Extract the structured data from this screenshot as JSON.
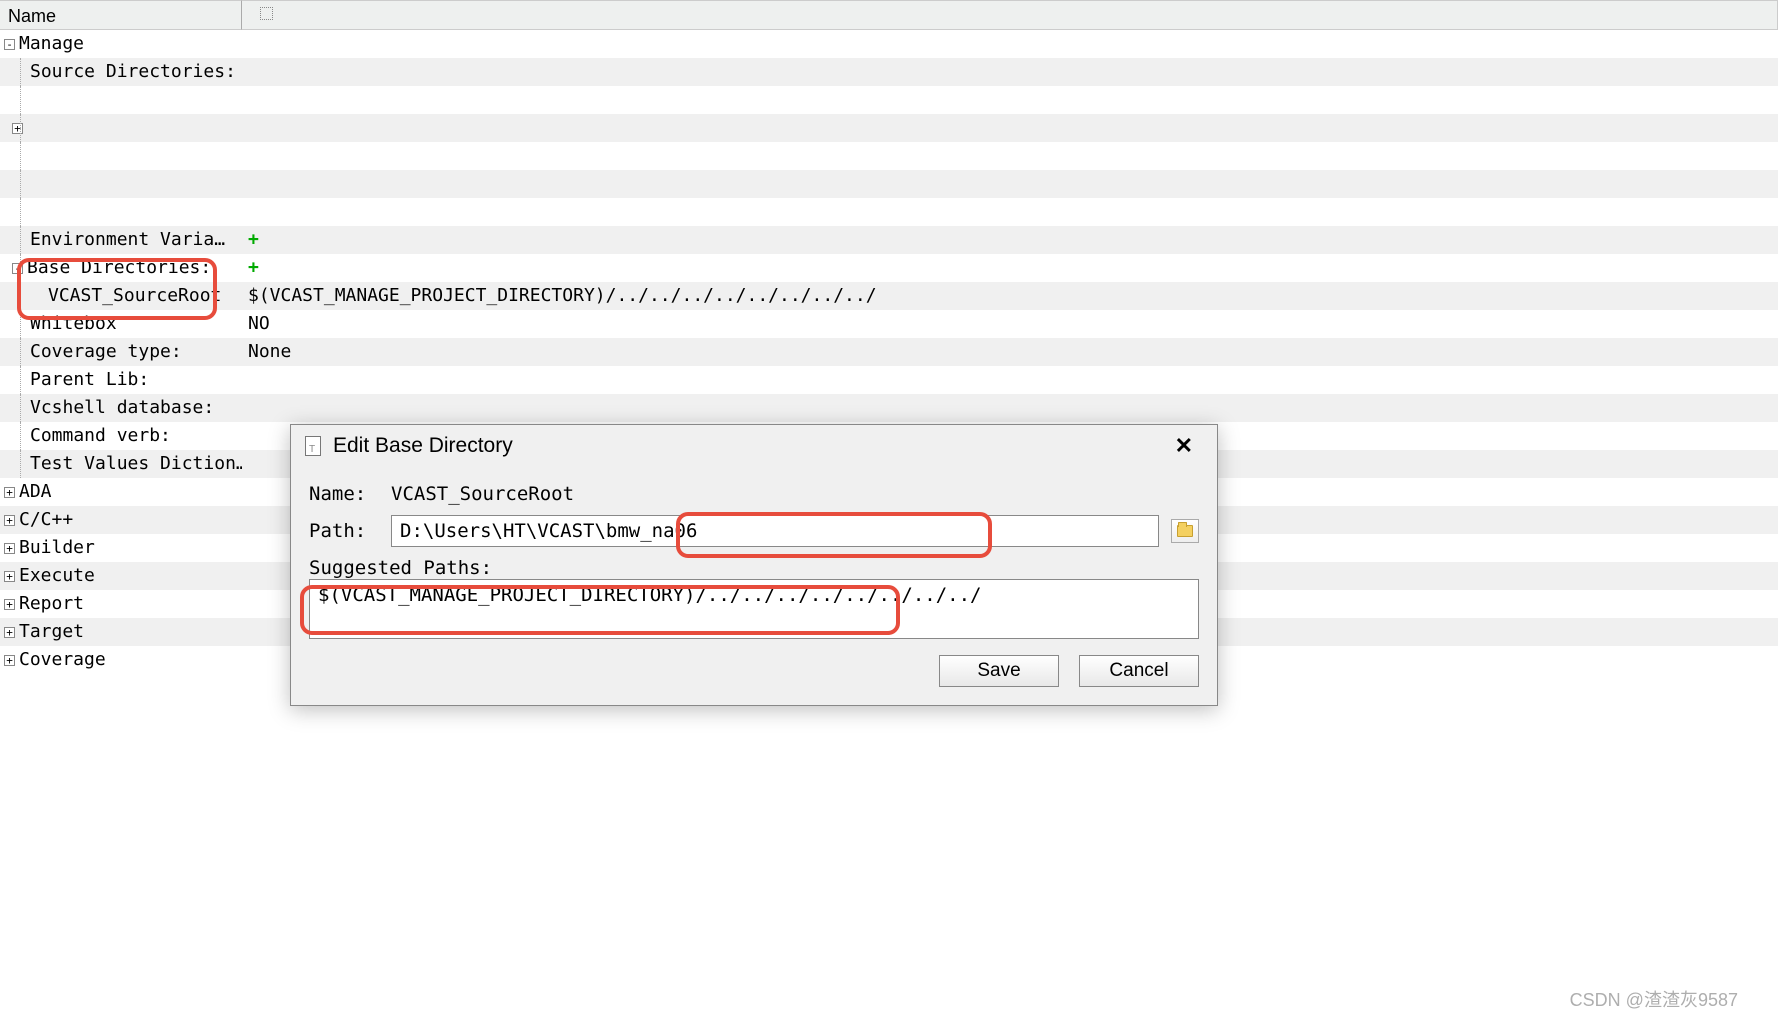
{
  "header": {
    "name_col": "Name"
  },
  "tree": {
    "manage": {
      "label": "Manage",
      "source_dirs": "Source Directories:",
      "env_vars": "Environment Varia…",
      "base_dirs": {
        "label": "Base Directories:",
        "child": {
          "name": "VCAST_SourceRoot",
          "value": "$(VCAST_MANAGE_PROJECT_DIRECTORY)/../../../../../../../../"
        }
      },
      "whitebox": {
        "label": "Whitebox",
        "value": "NO"
      },
      "coverage": {
        "label": "Coverage type:",
        "value": "None"
      },
      "parent_lib": {
        "label": "Parent Lib:"
      },
      "vcshell_db": {
        "label": "Vcshell database:"
      },
      "command_verb": {
        "label": "Command verb:"
      },
      "test_values": {
        "label": "Test Values Diction…"
      }
    },
    "others": [
      "ADA",
      "C/C++",
      "Builder",
      "Execute",
      "Report",
      "Target",
      "Coverage"
    ]
  },
  "dialog": {
    "title": "Edit Base Directory",
    "name_label": "Name:",
    "name_value": "VCAST_SourceRoot",
    "path_label": "Path:",
    "path_value": "D:\\Users\\HT\\VCAST\\bmw_na06",
    "suggested_label": "Suggested Paths:",
    "suggested_value": "$(VCAST_MANAGE_PROJECT_DIRECTORY)/../../../../../../../../",
    "save": "Save",
    "cancel": "Cancel"
  },
  "watermark": "CSDN @渣渣灰9587"
}
